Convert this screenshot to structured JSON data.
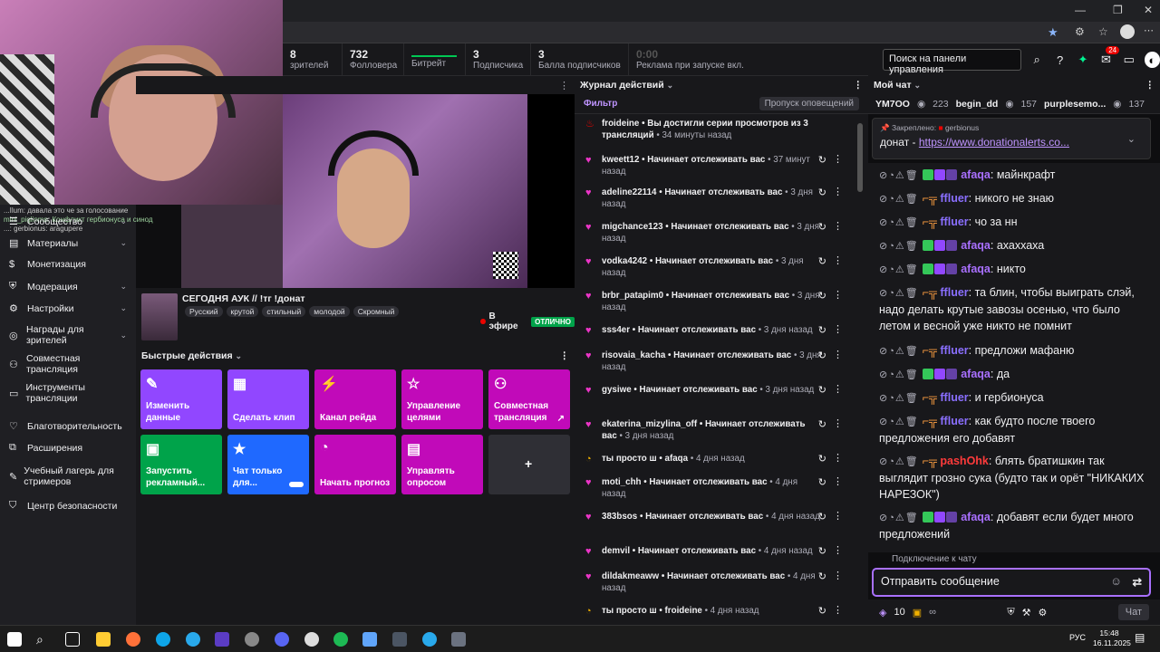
{
  "stats": [
    {
      "value": "8",
      "label": "зрителей"
    },
    {
      "value": "732",
      "label": "Фолловера"
    },
    {
      "value": "",
      "label": "Битрейт"
    },
    {
      "value": "3",
      "label": "Подписчика"
    },
    {
      "value": "3",
      "label": "Балла подписчиков"
    },
    {
      "value": "0:00",
      "label": "Реклама при запуске вкл."
    }
  ],
  "topright": {
    "search_label": "Поиск на панели управления",
    "notif_count": "24"
  },
  "webcam_overlay": {
    "lines": [
      "...Ilum: давала это че за голосование",
      "mini_piglinmn: Конфликт гербионуса и синод",
      "...: gerbionus: aragupere"
    ]
  },
  "leftnav": [
    {
      "label": "Сообщество",
      "icon": "community-icon",
      "chevron": true
    },
    {
      "label": "Материалы",
      "icon": "content-icon",
      "chevron": true
    },
    {
      "label": "Монетизация",
      "icon": "monetization-icon",
      "chevron": false
    },
    {
      "label": "Модерация",
      "icon": "moderation-icon",
      "chevron": true
    },
    {
      "label": "Настройки",
      "icon": "settings-icon",
      "chevron": true
    },
    {
      "label": "Награды для зрителей",
      "icon": "rewards-icon",
      "chevron": true
    },
    {
      "label": "Совместная трансляция",
      "icon": "collab-icon",
      "chevron": false
    },
    {
      "label": "Инструменты трансляции",
      "icon": "tools-icon",
      "chevron": false
    },
    {
      "label": "Благотворительность",
      "icon": "charity-icon",
      "chevron": false
    },
    {
      "label": "Расширения",
      "icon": "extensions-icon",
      "chevron": false
    },
    {
      "label": "Учебный лагерь для стримеров",
      "icon": "bootcamp-icon",
      "chevron": false
    },
    {
      "label": "Центр безопасности",
      "icon": "safety-icon",
      "chevron": false
    }
  ],
  "stream": {
    "title": "СЕГОДНЯ АУК // !тг !донат",
    "tags": [
      "Русский",
      "крутой",
      "стильный",
      "молодой",
      "Скромный"
    ],
    "live_label": "В эфире",
    "health_label": "ОТЛИЧНО"
  },
  "quick_actions": {
    "header": "Быстрые действия",
    "items": [
      {
        "label": "Изменить данные",
        "color": "purple"
      },
      {
        "label": "Сделать клип",
        "color": "purple"
      },
      {
        "label": "Канал рейда",
        "color": "magenta"
      },
      {
        "label": "Управление целями",
        "color": "magenta"
      },
      {
        "label": "Совместная трансляция",
        "color": "magenta"
      },
      {
        "label": "Запустить рекламный...",
        "color": "green"
      },
      {
        "label": "Чат только для...",
        "color": "blue"
      },
      {
        "label": "Начать прогноз",
        "color": "magenta"
      },
      {
        "label": "Управлять опросом",
        "color": "magenta"
      },
      {
        "label": "+",
        "color": "grey"
      }
    ]
  },
  "activity": {
    "header": "Журнал действий",
    "filter": "Фильтр",
    "skip": "Пропуск оповещений",
    "items": [
      {
        "user": "froideine",
        "text": " • Вы достигли серии просмотров из 3 трансляций",
        "time": " • 34 минуты назад",
        "type": "streak"
      },
      {
        "user": "kweett12",
        "text": " • Начинает отслеживать вас",
        "time": " • 37 минут назад",
        "type": "follow"
      },
      {
        "user": "adeline22114",
        "text": " • Начинает отслеживать вас",
        "time": " • 3 дня назад",
        "type": "follow"
      },
      {
        "user": "migchance123",
        "text": " • Начинает отслеживать вас",
        "time": " • 3 дня назад",
        "type": "follow"
      },
      {
        "user": "vodka4242",
        "text": " • Начинает отслеживать вас",
        "time": " • 3 дня назад",
        "type": "follow"
      },
      {
        "user": "brbr_patapim0",
        "text": " • Начинает отслеживать вас",
        "time": " • 3 дня назад",
        "type": "follow"
      },
      {
        "user": "sss4er",
        "text": " • Начинает отслеживать вас",
        "time": " • 3 дня назад",
        "type": "follow"
      },
      {
        "user": "risovaia_kacha",
        "text": " • Начинает отслеживать вас",
        "time": " • 3 дня назад",
        "type": "follow"
      },
      {
        "user": "gysiwe",
        "text": " • Начинает отслеживать вас",
        "time": " • 3 дня назад",
        "type": "follow"
      },
      {
        "user": "ekaterina_mizylina_off",
        "text": " • Начинает отслеживать вас",
        "time": " • 3 дня назад",
        "type": "follow"
      },
      {
        "user": "ты просто ш",
        "text": " • afaqa",
        "time": " • 4 дня назад",
        "type": "prediction"
      },
      {
        "user": "moti_chh",
        "text": " • Начинает отслеживать вас",
        "time": " • 4 дня назад",
        "type": "follow"
      },
      {
        "user": "383bsos",
        "text": " • Начинает отслеживать вас",
        "time": " • 4 дня назад",
        "type": "follow"
      },
      {
        "user": "demvil",
        "text": " • Начинает отслеживать вас",
        "time": " • 4 дня назад",
        "type": "follow"
      },
      {
        "user": "dildakmeaww",
        "text": " • Начинает отслеживать вас",
        "time": " • 4 дня назад",
        "type": "follow"
      },
      {
        "user": "ты просто ш",
        "text": " • froideine",
        "time": " • 4 дня назад",
        "type": "prediction"
      }
    ]
  },
  "chat": {
    "header": "Мой чат",
    "chatters": [
      {
        "name": "YM7OO",
        "count": "223"
      },
      {
        "name": "begin_dd",
        "count": "157"
      },
      {
        "name": "purplesemo...",
        "count": "137"
      }
    ],
    "pinned_label": "Закреплено:",
    "pinned_by": "gerbionus",
    "pinned_text": "донат - ",
    "pinned_link": "https://www.donationalerts.co...",
    "messages": [
      {
        "user": "afaqa",
        "color": "#a970ff",
        "text": ": майнкрафт",
        "badges": true
      },
      {
        "user": "ffluer",
        "color": "#8a6fff",
        "text": ": никого не знаю",
        "badges": false
      },
      {
        "user": "ffluer",
        "color": "#8a6fff",
        "text": ": чо за нн",
        "badges": false
      },
      {
        "user": "afaqa",
        "color": "#a970ff",
        "text": ": ахаххаха",
        "badges": true
      },
      {
        "user": "afaqa",
        "color": "#a970ff",
        "text": ": никто",
        "badges": true
      },
      {
        "user": "ffluer",
        "color": "#8a6fff",
        "text": ": та блин, чтобы выиграть слэй, надо делать крутые завозы осенью, что было летом и весной уже никто не помнит",
        "badges": false
      },
      {
        "user": "ffluer",
        "color": "#8a6fff",
        "text": ": предложи мафаню",
        "badges": false
      },
      {
        "user": "afaqa",
        "color": "#a970ff",
        "text": ": да",
        "badges": true
      },
      {
        "user": "ffluer",
        "color": "#8a6fff",
        "text": ": и гербионуса",
        "badges": false
      },
      {
        "user": "ffluer",
        "color": "#8a6fff",
        "text": ": как будто после твоего предложения его добавят",
        "badges": false
      },
      {
        "user": "pashOhk",
        "color": "#ff3b3b",
        "text": ": блять братишкин так выглядит грозно сука (будто так и орёт \"НИКАКИХ НАРЕЗОК\")",
        "badges": false
      },
      {
        "user": "afaqa",
        "color": "#a970ff",
        "text": ": добавят если будет много предложений",
        "badges": true
      }
    ],
    "connecting": "Подключение к чату",
    "input_placeholder": "Отправить сообщение",
    "points": "10",
    "chat_button": "Чат"
  },
  "taskbar": {
    "lang": "РУС",
    "time": "15:48",
    "date": "16.11.2025"
  }
}
